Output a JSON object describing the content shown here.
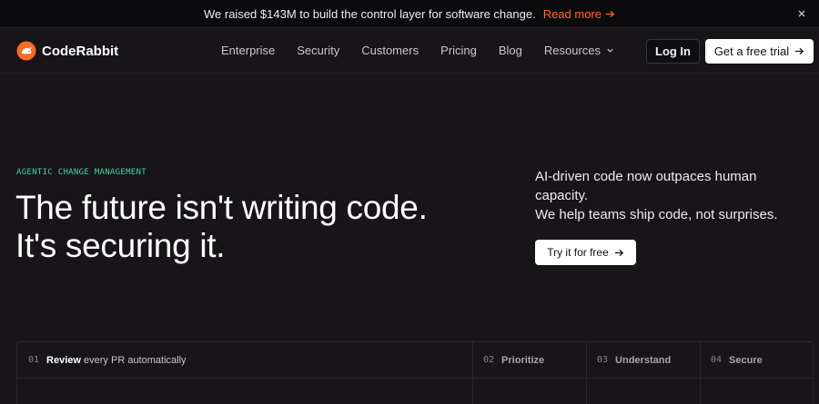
{
  "announcement": {
    "text": "We raised $143M to build the control layer for software change.",
    "link": "Read more"
  },
  "nav": {
    "brand": "CodeRabbit",
    "items": [
      "Enterprise",
      "Security",
      "Customers",
      "Pricing",
      "Blog",
      "Resources"
    ],
    "login": "Log In",
    "cta": "Get a free trial"
  },
  "hero": {
    "eyebrow": "AGENTIC CHANGE MANAGEMENT",
    "headline": [
      "The future isn't writing code.",
      "It's securing it."
    ],
    "sub": [
      "AI-driven code now outpaces human capacity.",
      "We help teams ship code, not surprises."
    ],
    "cta": "Try it for free"
  },
  "steps": [
    {
      "num": "01",
      "title": "Review",
      "tail": "every PR automatically"
    },
    {
      "num": "02",
      "title": "Prioritize",
      "tail": ""
    },
    {
      "num": "03",
      "title": "Understand",
      "tail": ""
    },
    {
      "num": "04",
      "title": "Secure",
      "tail": ""
    }
  ],
  "colors": {
    "background": "#171518",
    "accent": "#ff6a1f",
    "eyebrow": "#3fd6a6"
  }
}
